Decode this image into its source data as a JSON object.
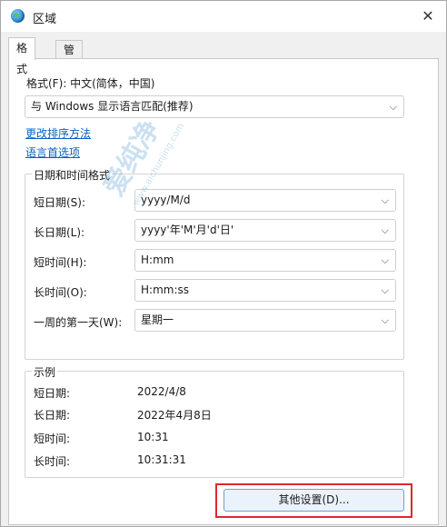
{
  "window": {
    "title": "区域"
  },
  "tabs": [
    {
      "label": "格式",
      "active": true
    },
    {
      "label": "管理",
      "active": false
    }
  ],
  "format": {
    "label": "格式(F): 中文(简体，中国)",
    "selected": "与 Windows 显示语言匹配(推荐)"
  },
  "links": {
    "sort": "更改排序方法",
    "language": "语言首选项"
  },
  "datetime": {
    "title": "日期和时间格式",
    "rows": [
      {
        "label": "短日期(S):",
        "value": "yyyy/M/d"
      },
      {
        "label": "长日期(L):",
        "value": "yyyy'年'M'月'd'日'"
      },
      {
        "label": "短时间(H):",
        "value": "H:mm"
      },
      {
        "label": "长时间(O):",
        "value": "H:mm:ss"
      },
      {
        "label": "一周的第一天(W):",
        "value": "星期一"
      }
    ]
  },
  "examples": {
    "title": "示例",
    "rows": [
      {
        "label": "短日期:",
        "value": "2022/4/8"
      },
      {
        "label": "长日期:",
        "value": "2022年4月8日"
      },
      {
        "label": "短时间:",
        "value": "10:31"
      },
      {
        "label": "长时间:",
        "value": "10:31:31"
      }
    ]
  },
  "buttons": {
    "other_settings": "其他设置(D)..."
  },
  "watermark": {
    "brand": "爱纯净",
    "url": "www.aichunjing.com"
  },
  "colors": {
    "link": "#0a62c2",
    "highlight": "#e0272d"
  },
  "icons": {
    "app": "globe-icon",
    "close": "close-icon",
    "dropdown": "chevron-down-icon"
  }
}
